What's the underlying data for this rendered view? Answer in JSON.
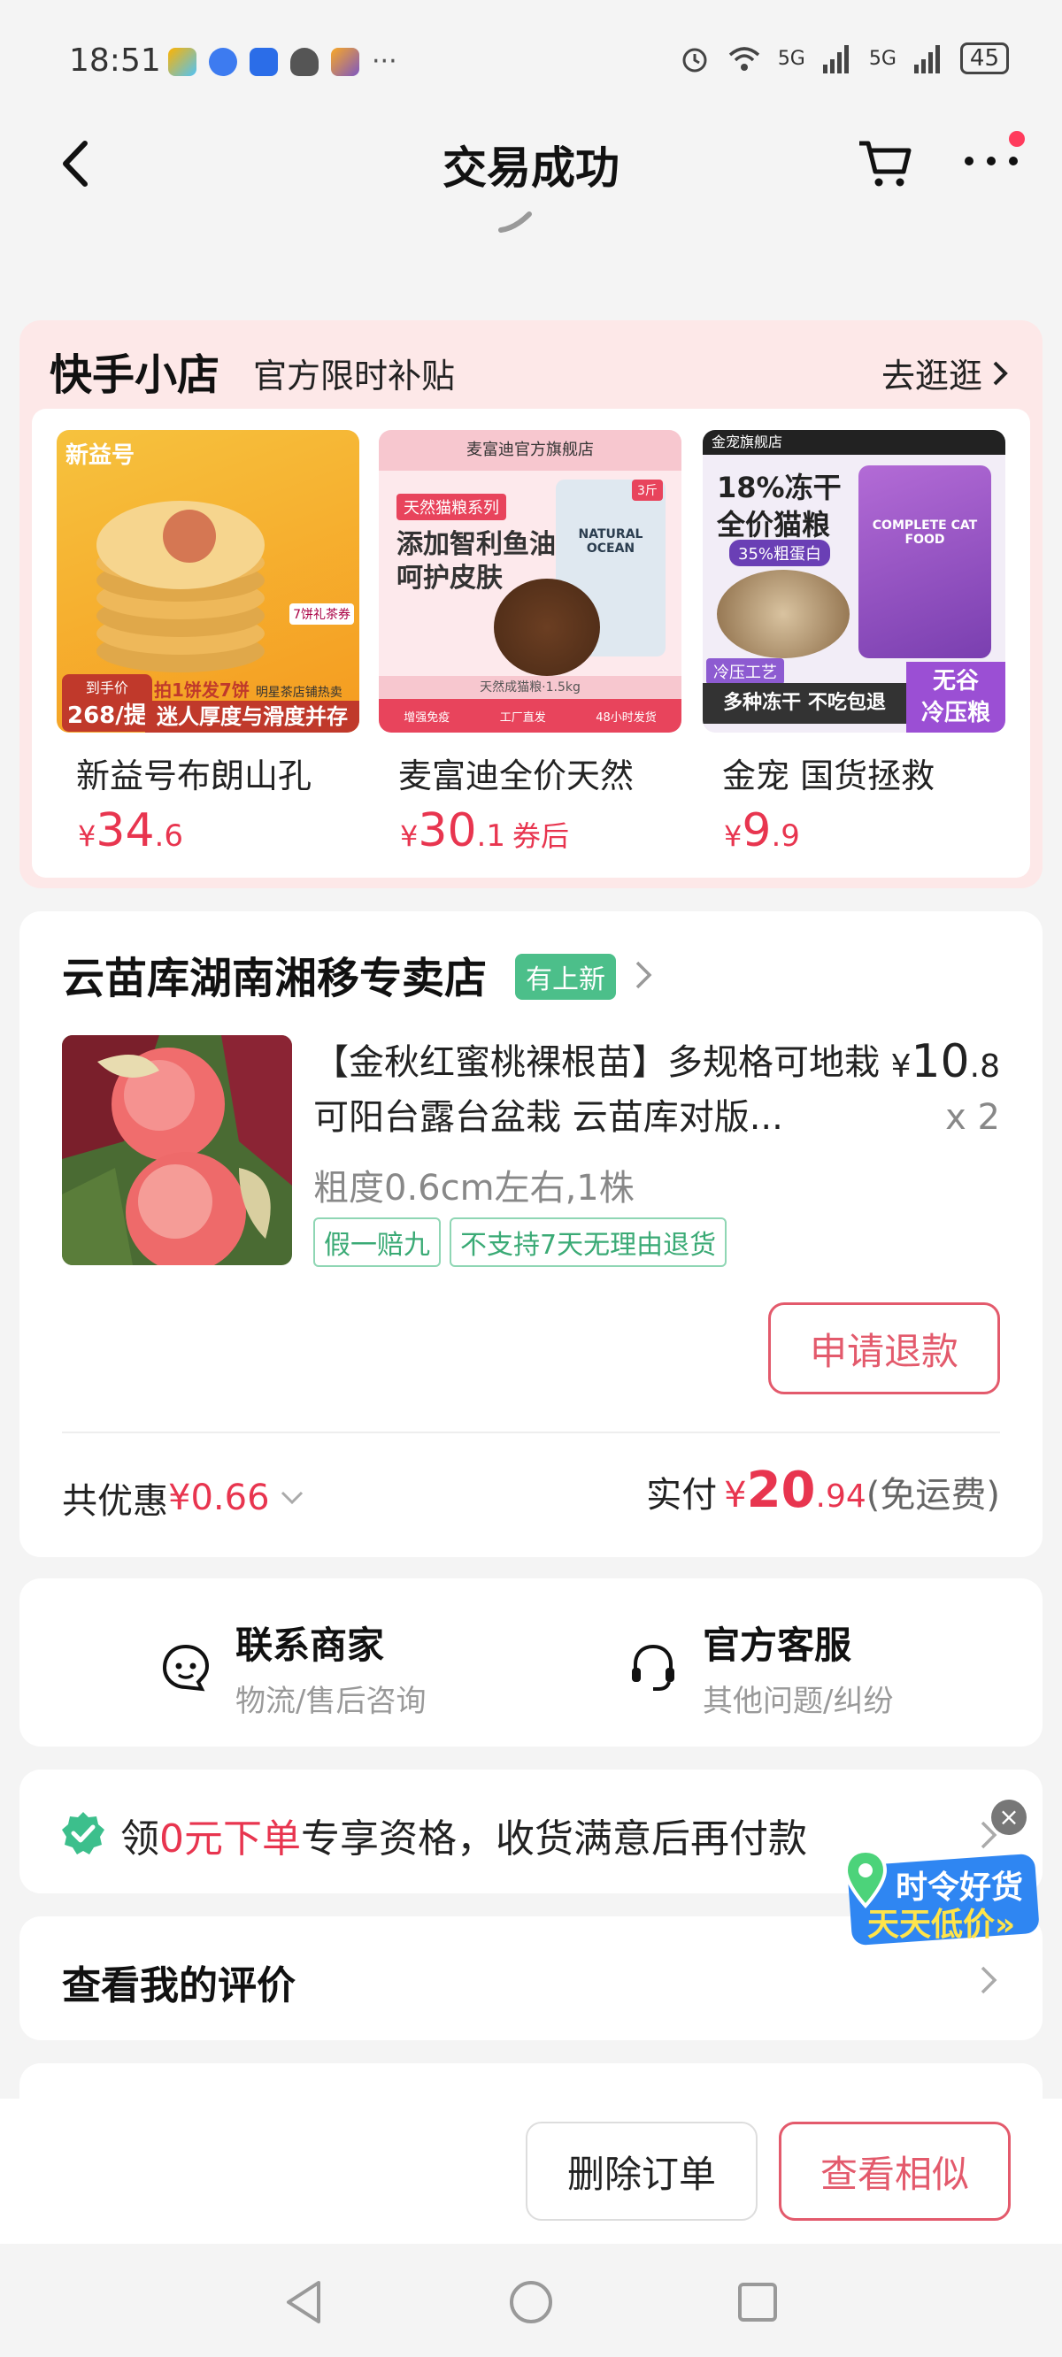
{
  "status_bar": {
    "time": "18:51",
    "battery": "45",
    "signal": "5G"
  },
  "nav": {
    "title": "交易成功"
  },
  "promo": {
    "title": "快手小店",
    "subtitle": "官方限时补贴",
    "link": "去逛逛",
    "products": [
      {
        "name": "新益号布朗山孔",
        "price_symbol": "¥",
        "price_int": "34",
        "price_dec": ".6",
        "coupon": "",
        "img_top": "新益号",
        "img_badge": "到手价",
        "img_badge_price": "268/提",
        "img_line1": "拍1饼发7饼",
        "img_line1b": "明星茶店铺热卖",
        "img_line2": "迷人厚度与滑度并存",
        "img_side": "7饼礼茶券"
      },
      {
        "name": "麦富迪全价天然",
        "price_symbol": "¥",
        "price_int": "30",
        "price_dec": ".1",
        "coupon": "券后",
        "img_brand": "麦富迪官方旗舰店",
        "img_series": "天然猫粮系列",
        "img_line1": "添加智利鱼油",
        "img_line2": "呵护皮肤",
        "img_pack": "NATURAL OCEAN",
        "img_weight": "天然成猫粮·1.5kg",
        "img_foot": [
          "增强免疫",
          "工厂直发",
          "48小时发货"
        ],
        "img_tag": "3斤"
      },
      {
        "name": "金宠 国货拯救",
        "price_symbol": "¥",
        "price_int": "9",
        "price_dec": ".9",
        "coupon": "",
        "img_store": "金宠旗舰店",
        "img_line1": "18%冻干",
        "img_line2": "全价猫粮",
        "img_protein": "35%粗蛋白",
        "img_craft": "冷压工艺",
        "img_line3": "多种冻干 不吃包退",
        "img_corner1": "无谷",
        "img_corner2": "冷压粮",
        "img_pack": "COMPLETE CAT FOOD"
      }
    ]
  },
  "order": {
    "shop_name": "云苗库湖南湘移专卖店",
    "shop_tag": "有上新",
    "item_title": "【金秋红蜜桃裸根苗】多规格可地栽可阳台露台盆栽 云苗库对版...",
    "price_symbol": "¥",
    "price_int": "10",
    "price_dec": ".8",
    "qty": "x 2",
    "spec": "粗度0.6cm左右,1株",
    "tags": [
      "假一赔九",
      "不支持7天无理由退货"
    ],
    "refund_button": "申请退款",
    "discount_label": "共优惠",
    "discount_value": "¥0.66",
    "paid_label": "实付",
    "paid_symbol": "¥",
    "paid_int": "20",
    "paid_dec": ".94",
    "paid_note": "(免运费)"
  },
  "contact": {
    "merchant_title": "联系商家",
    "merchant_sub": "物流/售后咨询",
    "service_title": "官方客服",
    "service_sub": "其他问题/纠纷"
  },
  "zero_promo": {
    "pre": "领",
    "highlight": "0元下单",
    "post": "专享资格，收货满意后再付款"
  },
  "review": {
    "label": "查看我的评价"
  },
  "float_badge": {
    "line1": "时令好货",
    "line2": "天天低价»",
    "close": "×"
  },
  "actions": {
    "delete": "删除订单",
    "similar": "查看相似"
  },
  "colors": {
    "accent_red": "#e8354f",
    "green_tag": "#4cbf8a",
    "promo_bg": "#fde8e8"
  }
}
